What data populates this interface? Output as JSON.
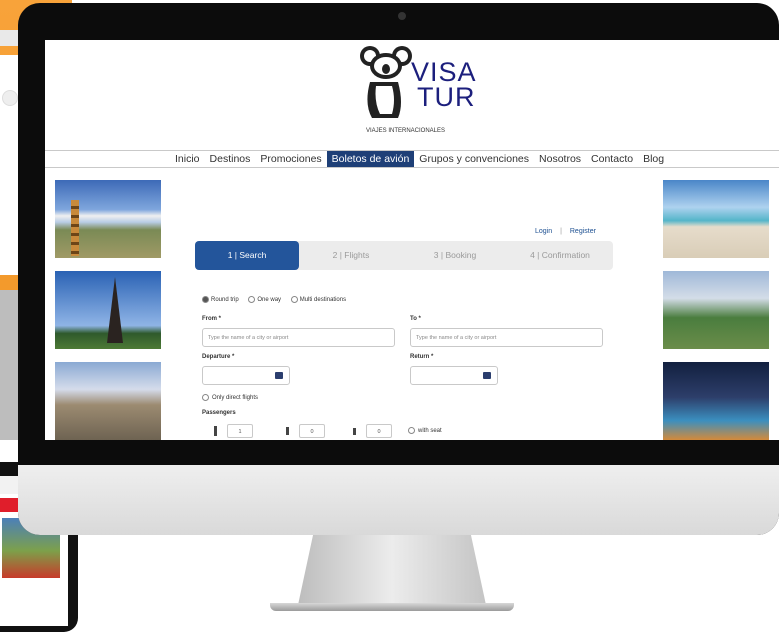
{
  "logo": {
    "line1": "VISA",
    "line2": "TUR",
    "subtitle": "VIAJES INTERNACIONALES",
    "color": "#1c1f7d"
  },
  "nav": {
    "items": [
      "Inicio",
      "Destinos",
      "Promociones",
      "Boletos de avión",
      "Grupos y convenciones",
      "Nosotros",
      "Contacto",
      "Blog"
    ],
    "active_index": 3,
    "active_color": "#1e3f77"
  },
  "auth": {
    "login": "Login",
    "separator": "|",
    "register": "Register"
  },
  "steps": [
    {
      "label": "1 | Search",
      "active": true
    },
    {
      "label": "2 | Flights",
      "active": false
    },
    {
      "label": "3 | Booking",
      "active": false
    },
    {
      "label": "4 | Confirmation",
      "active": false
    }
  ],
  "form": {
    "trip_types": [
      "Round trip",
      "One way",
      "Multi destinations"
    ],
    "trip_selected": "Round trip",
    "from_label": "From *",
    "from_placeholder": "Type the name of a city or airport",
    "to_label": "To *",
    "to_placeholder": "Type the name of a city or airport",
    "departure_label": "Departure *",
    "return_label": "Return *",
    "direct_flights_label": "Only direct flights",
    "passengers_label": "Passengers",
    "pax_values": [
      "1",
      "0",
      "0"
    ],
    "with_seat_label": "with seat"
  },
  "icons": {
    "calendar": "calendar-icon",
    "person": "person-icon"
  }
}
